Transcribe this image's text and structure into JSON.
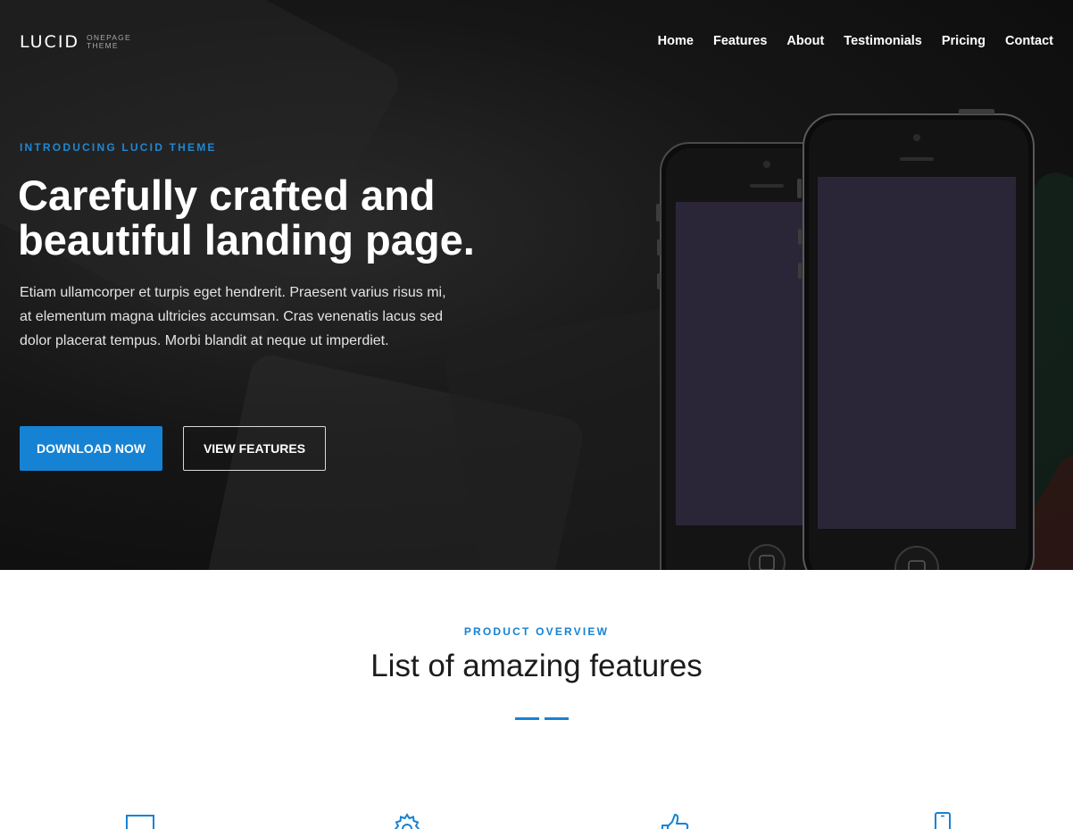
{
  "brand": {
    "name": "LUCID",
    "tagline_line1": "ONEPAGE",
    "tagline_line2": "THEME"
  },
  "nav": {
    "items": [
      "Home",
      "Features",
      "About",
      "Testimonials",
      "Pricing",
      "Contact"
    ]
  },
  "hero": {
    "eyebrow": "INTRODUCING LUCID THEME",
    "headline_line1": "Carefully crafted and",
    "headline_line2": "beautiful landing page.",
    "lead": "Etiam ullamcorper et turpis eget hendrerit. Praesent varius risus mi, at elementum magna ultricies accumsan. Cras venenatis lacus sed dolor placerat tempus. Morbi blandit at neque ut imperdiet.",
    "primary_button": "DOWNLOAD NOW",
    "secondary_button": "VIEW FEATURES"
  },
  "features": {
    "eyebrow": "PRODUCT OVERVIEW",
    "title": "List of amazing features",
    "icons": [
      "laptop-icon",
      "gear-icon",
      "thumbs-up-icon",
      "smartphone-icon"
    ]
  },
  "colors": {
    "accent": "#1682d4",
    "hero_bg": "#111111",
    "text_dark": "#1c1c1c"
  }
}
